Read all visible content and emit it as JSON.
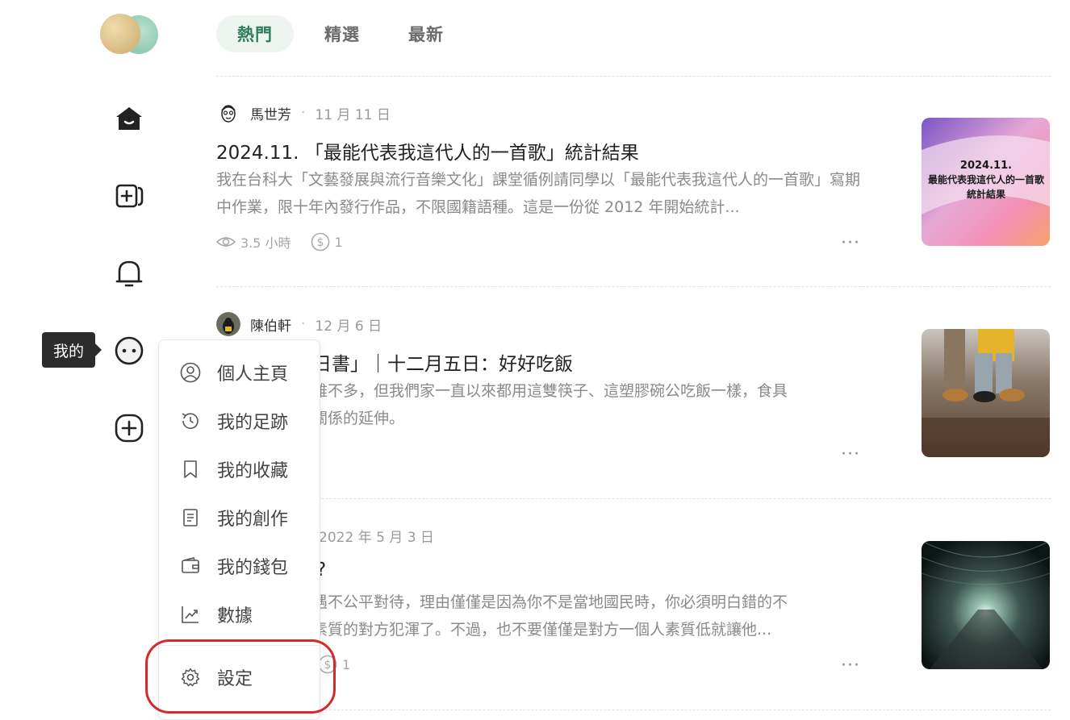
{
  "tabs": [
    {
      "label": "熱門",
      "active": true
    },
    {
      "label": "精選",
      "active": false
    },
    {
      "label": "最新",
      "active": false
    }
  ],
  "sidebar": {
    "tooltip": "我的",
    "icons": [
      "home-icon",
      "new-post-icon",
      "bell-icon",
      "profile-dots-icon",
      "add-icon"
    ]
  },
  "articles": [
    {
      "author": "馬世芳",
      "date": "11 月 11 日",
      "title": "2024.11. 「最能代表我這代人的一首歌」統計結果",
      "excerpt": "我在台科大「文藝發展與流行音樂文化」課堂循例請同學以「最能代表我這代人的一首歌」寫期中作業，限十年內發行作品，不限國籍語種。這是一份從 2012 年開始統計...",
      "read_time": "3.5 小時",
      "coins": "1",
      "thumb_text": {
        "line1": "2024.11.",
        "line2": "最能代表我這代人的一首歌",
        "line3": "統計結果"
      }
    },
    {
      "author": "陳伯軒",
      "date": "12 月 6 日",
      "title": "日書」｜十二月五日：好好吃飯",
      "excerpt_line1": "值雖不多，但我們家一直以來都用這雙筷子、這塑膠碗公吃飯一樣，食具",
      "excerpt_line2": "庭關係的延伸。"
    },
    {
      "date": "2022 年 5 月 3 日",
      "title": "?",
      "excerpt_line1": "遭遇不公平對待，理由僅僅是因為你不是當地國民時，你必須明白錯的不",
      "excerpt_line2": "有素質的對方犯渾了。不過，也不要僅僅是對方一個人素質低就讓他...",
      "coins": "1"
    }
  ],
  "more_label": "···",
  "menu": {
    "items": [
      {
        "label": "個人主頁",
        "icon": "user-circle-icon"
      },
      {
        "label": "我的足跡",
        "icon": "history-icon"
      },
      {
        "label": "我的收藏",
        "icon": "bookmark-icon"
      },
      {
        "label": "我的創作",
        "icon": "document-icon"
      },
      {
        "label": "我的錢包",
        "icon": "wallet-icon"
      },
      {
        "label": "數據",
        "icon": "chart-icon"
      }
    ],
    "settings": {
      "label": "設定",
      "icon": "gear-icon"
    }
  },
  "colors": {
    "accent": "#2f7d5b",
    "tab_bg": "#eef5f1",
    "highlight": "#d42a2a"
  }
}
